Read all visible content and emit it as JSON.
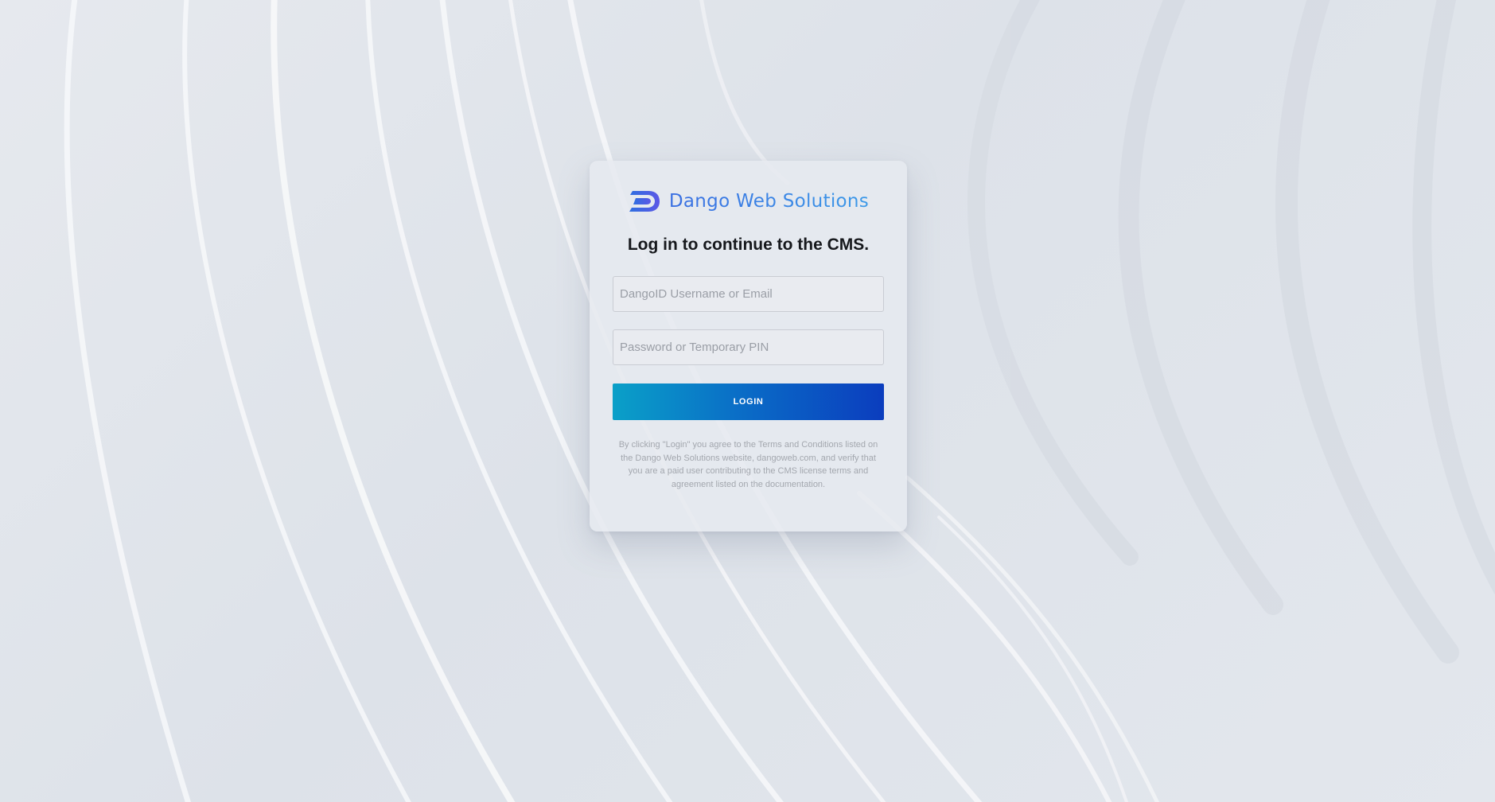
{
  "brand": {
    "name": "Dango Web Solutions",
    "logo_icon": "dango-d-logo-icon",
    "accent_color": "#3d7fe3"
  },
  "login": {
    "headline": "Log in to continue to the CMS.",
    "username_placeholder": "DangoID Username or Email",
    "username_value": "",
    "password_placeholder": "Password or Temporary PIN",
    "password_value": "",
    "button_label": "LOGIN",
    "button_gradient": [
      "#0aa0c8",
      "#0b3dbe"
    ],
    "disclaimer": "By clicking \"Login\" you agree to the Terms and Conditions listed on the Dango Web Solutions website, dangoweb.com, and verify that you are a paid user contributing to the CMS license terms and agreement listed on the documentation."
  }
}
